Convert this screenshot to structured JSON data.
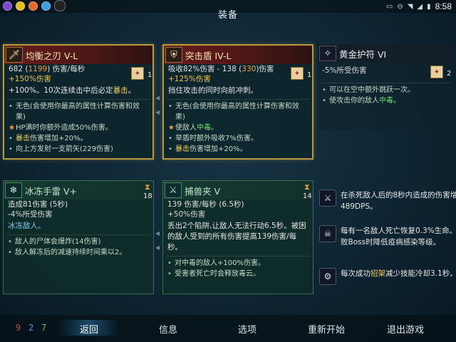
{
  "status": {
    "time": "8:58"
  },
  "page_title": "装备",
  "cards": {
    "balance": {
      "name": "均衡之刃 V-L",
      "stats_a": "682 (",
      "stats_b": "1199",
      "stats_c": ") 伤害/每秒",
      "sub": "+150%伤害",
      "count": "1",
      "desc_a": "+100%。10次连续击中后必定",
      "desc_hl": "暴击",
      "desc_b": "。",
      "effects": [
        {
          "text": "无色(会使用你最高的属性计算伤害和效果)",
          "hl": ""
        },
        {
          "text": "HP满时你额外造成50%伤害。",
          "hl": ""
        },
        {
          "text": "伤害增加+20%。",
          "hl": "暴击"
        },
        {
          "text": "向上方发射一支箭矢(229伤害)",
          "hl": ""
        }
      ]
    },
    "shield": {
      "name": "突击盾 IV-L",
      "stats_a": "吸收82%伤害 - 138 (",
      "stats_b": "330",
      "stats_c": ")伤害",
      "sub": "+125%伤害",
      "count": "1",
      "desc": "挡住攻击的同时向前冲刺。",
      "effects": [
        {
          "text": "无色(会使用你最高的属性计算伤害和效果)",
          "hl": "",
          "gn": ""
        },
        {
          "text": "",
          "hl": "",
          "gn_pre": "使敌人",
          "gn": "中毒",
          "post": "。"
        },
        {
          "text": "举盾时额外吸收7%伤害。",
          "hl": "",
          "gn": ""
        },
        {
          "text": "伤害增加+20%。",
          "hl": "暴击",
          "gn": ""
        }
      ]
    },
    "amulet": {
      "name": "黄金护符 VI",
      "sub": "-5%所受伤害",
      "count": "2",
      "effects": [
        {
          "text": "可以在空中额外跳跃一次。"
        },
        {
          "pre": "使攻击你的敌人",
          "gn": "中毒",
          "post": "。"
        }
      ]
    },
    "grenade": {
      "name": "冰冻手雷 V+",
      "timer": "18",
      "stats": "造成81伤害 (5秒)",
      "sub": "-4%所受伤害",
      "desc": "冰冻敌人。",
      "effects": [
        "敌人的尸体会爆炸(14伤害)",
        "敌人解冻后的减速持续时间乘以2。"
      ]
    },
    "trap": {
      "name": "捕兽夹 V",
      "timer": "14",
      "stats": "139 伤害/每秒 (6.5秒)",
      "sub": "+50%伤害",
      "desc": "丢出2个陷阱,让敌人无法行动6.5秒。被困的敌人受到的所有伤害提高139伤害/每秒。",
      "effects": [
        "对中毒的敌人+100%伤害。",
        "受害者死亡时会释放毒云。"
      ]
    }
  },
  "mutations": [
    {
      "text": "在杀死敌人后的8秒内造成的伤害增加489DPS。",
      "hl": ""
    },
    {
      "text": "每有一名敌人死亡恢复0.3%生命。击败Boss时降低疫病感染等级。",
      "hl": ""
    },
    {
      "pre": "每次成功",
      "hl": "招架",
      "post": "减少技能冷却3.1秒。"
    }
  ],
  "souls": {
    "red": "9",
    "blue": "2",
    "green": "7"
  },
  "nav": {
    "back": "返回",
    "info": "信息",
    "options": "选项",
    "restart": "重新开始",
    "quit": "退出游戏"
  },
  "colors": {
    "red": "#d04040",
    "blue": "#6a8ee0",
    "green": "#4ac070",
    "gold": "#e8c14a"
  }
}
